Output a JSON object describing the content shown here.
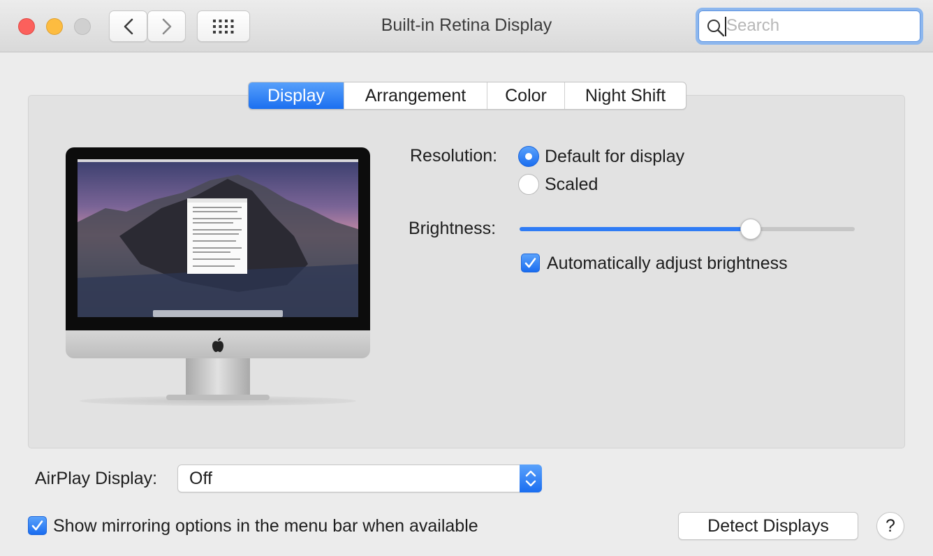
{
  "window": {
    "title": "Built-in Retina Display"
  },
  "toolbar": {
    "back_icon": "chevron-left-icon",
    "forward_icon": "chevron-right-icon",
    "show_all_icon": "grid-icon",
    "search_placeholder": "Search",
    "search_value": ""
  },
  "tabs": [
    {
      "label": "Display",
      "selected": true
    },
    {
      "label": "Arrangement",
      "selected": false
    },
    {
      "label": "Color",
      "selected": false
    },
    {
      "label": "Night Shift",
      "selected": false
    }
  ],
  "display": {
    "resolution_label": "Resolution:",
    "resolution_options": [
      {
        "label": "Default for display",
        "selected": true
      },
      {
        "label": "Scaled",
        "selected": false
      }
    ],
    "brightness_label": "Brightness:",
    "brightness_value": 0.69,
    "auto_brightness_label": "Automatically adjust brightness",
    "auto_brightness_checked": true
  },
  "airplay": {
    "label": "AirPlay Display:",
    "value": "Off"
  },
  "mirroring": {
    "label": "Show mirroring options in the menu bar when available",
    "checked": true
  },
  "detect_button": "Detect Displays",
  "help_button": "?",
  "colors": {
    "accent": "#1b6ff0",
    "close": "#fc605c",
    "minimize": "#fdbc40",
    "zoom": "#d0d0d0"
  }
}
